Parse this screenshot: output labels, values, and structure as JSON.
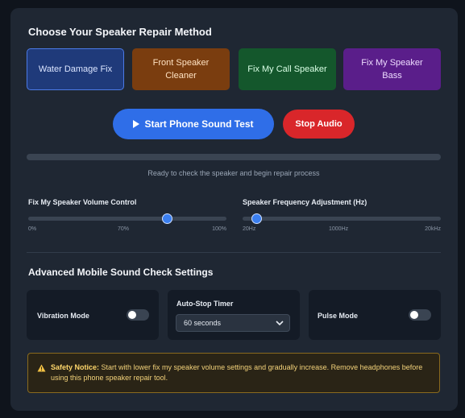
{
  "title": "Choose Your Speaker Repair Method",
  "methods": [
    {
      "label": "Water Damage Fix"
    },
    {
      "label": "Front Speaker Cleaner"
    },
    {
      "label": "Fix My Call Speaker"
    },
    {
      "label": "Fix My Speaker Bass"
    }
  ],
  "controls": {
    "start_label": "Start Phone Sound Test",
    "stop_label": "Stop Audio"
  },
  "progress": {
    "value": 0
  },
  "status": "Ready to check the speaker and begin repair process",
  "volume": {
    "label": "Fix My Speaker Volume Control",
    "ticks": [
      "0%",
      "70%",
      "100%"
    ],
    "value_percent": 70
  },
  "frequency": {
    "label": "Speaker Frequency Adjustment (Hz)",
    "ticks": [
      "20Hz",
      "1000Hz",
      "20kHz"
    ],
    "value_position": 0.07
  },
  "advanced": {
    "title": "Advanced Mobile Sound Check Settings",
    "vibration_label": "Vibration Mode",
    "vibration_on": false,
    "timer_label": "Auto-Stop Timer",
    "timer_value": "60 seconds",
    "pulse_label": "Pulse Mode",
    "pulse_on": false
  },
  "notice": {
    "title": "Safety Notice:",
    "text": " Start with lower fix my speaker volume settings and gradually increase. Remove headphones before using this phone speaker repair tool."
  },
  "colors": {
    "accent": "#2f6ee8",
    "stop": "#d9262a",
    "warning": "#f3d27a"
  }
}
